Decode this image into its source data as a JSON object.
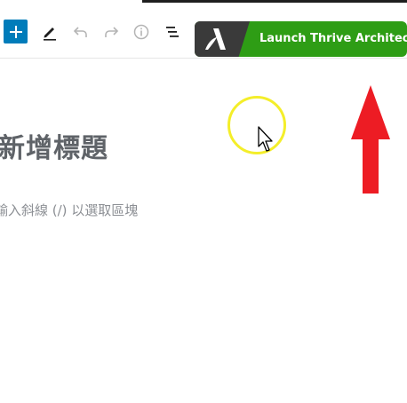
{
  "toolbar": {
    "add_block_icon": "plus-icon",
    "tools_icon": "pencil-icon",
    "undo_icon": "undo-icon",
    "redo_icon": "redo-icon",
    "details_icon": "info-icon",
    "list_view_icon": "list-view-icon",
    "launch_button": {
      "label": "Launch Thrive Architect",
      "logo_icon": "thrive-architect-logo-icon",
      "color": "#2e9d15",
      "logo_bg": "#3a3a3a"
    },
    "accent": "#007cba"
  },
  "editor": {
    "title_placeholder": "新增標題",
    "block_placeholder": "輸入斜線 (/) 以選取區塊"
  },
  "overlays": {
    "cursor_highlight_color": "#f4ee2a",
    "arrow_color": "#ed1c24",
    "mouse_cursor_icon": "mouse-pointer-icon",
    "arrow_icon": "up-arrow-annotation-icon"
  }
}
